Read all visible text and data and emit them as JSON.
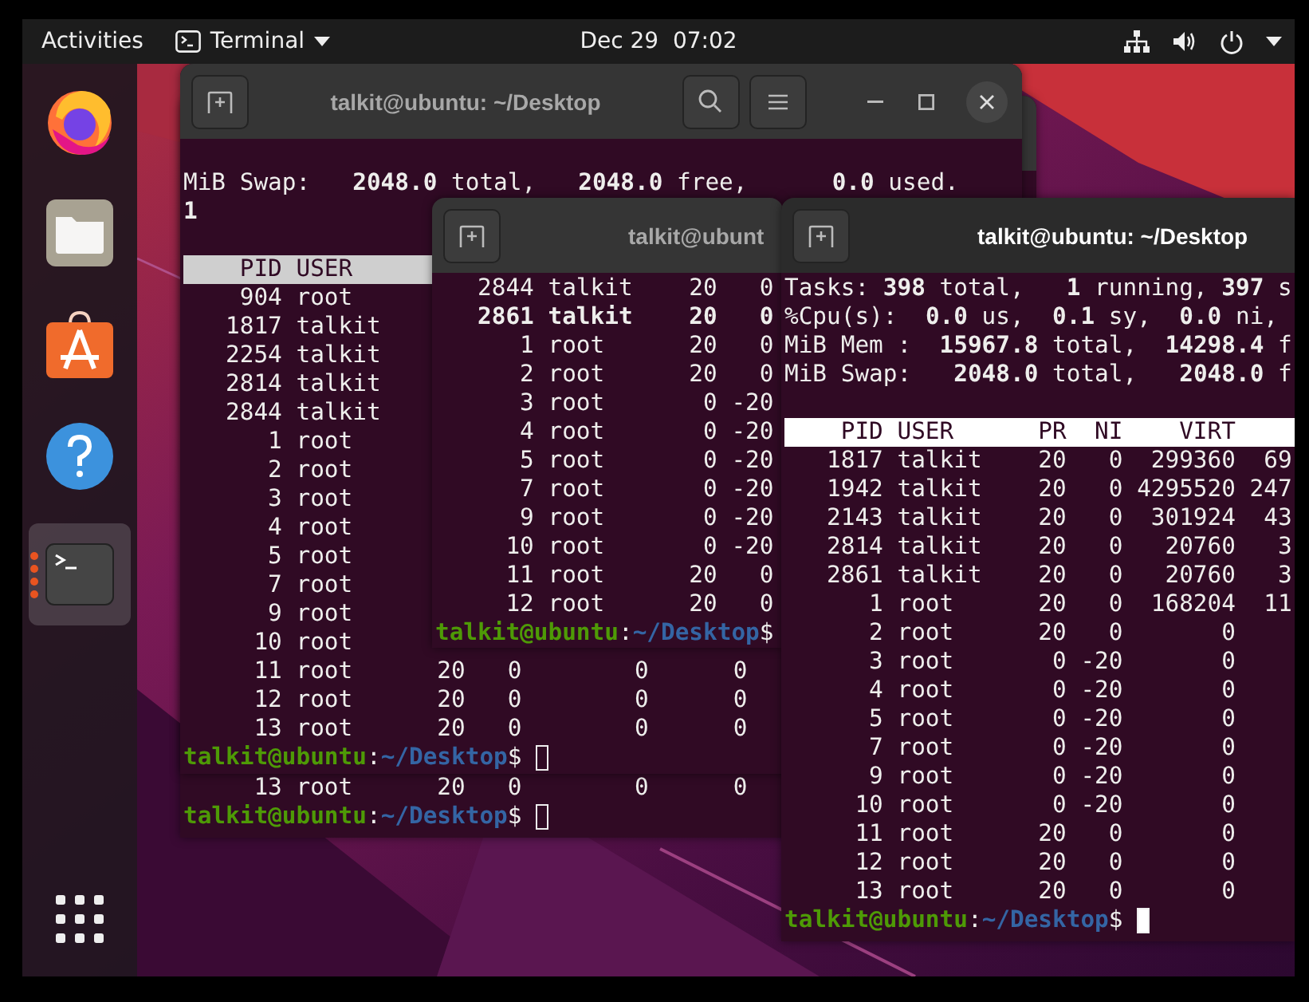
{
  "top_bar": {
    "activities": "Activities",
    "app_menu": "Terminal",
    "clock": "Dec 29  07:02"
  },
  "dock": [
    {
      "kind": "firefox",
      "running": false,
      "selected": false
    },
    {
      "kind": "files",
      "running": false,
      "selected": false
    },
    {
      "kind": "software",
      "running": false,
      "selected": false
    },
    {
      "kind": "help",
      "running": false,
      "selected": false
    },
    {
      "kind": "terminal",
      "running": true,
      "selected": true
    }
  ],
  "windows": [
    {
      "title": "talkit@ubuntu: ~/Desktop",
      "focused": false,
      "lines": [
        {
          "kind": "blank"
        },
        {
          "kind": "text",
          "text": "MiB Swap:   **2048.0** total,   **2048.0** free,      **0.0** used."
        },
        {
          "kind": "text",
          "text": "**1**"
        },
        {
          "kind": "blank"
        },
        {
          "kind": "header",
          "text": "    PID USER"
        },
        {
          "kind": "text",
          "text": "    904 root"
        },
        {
          "kind": "text",
          "text": "   1817 talkit"
        },
        {
          "kind": "text",
          "text": "   2254 talkit"
        },
        {
          "kind": "text",
          "text": "   2814 talkit"
        },
        {
          "kind": "text",
          "text": "   2844 talkit"
        },
        {
          "kind": "text",
          "text": "      1 root"
        },
        {
          "kind": "text",
          "text": "      2 root"
        },
        {
          "kind": "text",
          "text": "      3 root"
        },
        {
          "kind": "text",
          "text": "      4 root"
        },
        {
          "kind": "text",
          "text": "      5 root"
        },
        {
          "kind": "text",
          "text": "      7 root"
        },
        {
          "kind": "text",
          "text": "      9 root"
        },
        {
          "kind": "text",
          "text": "     10 root"
        },
        {
          "kind": "text",
          "text": "     11 root      20   0        0      0"
        },
        {
          "kind": "text",
          "text": "     12 root      20   0        0      0"
        },
        {
          "kind": "text",
          "text": "     13 root      20   0        0      0"
        },
        {
          "kind": "prompt",
          "parts": [
            {
              "kind": "user",
              "text": "talkit@ubuntu"
            },
            {
              "kind": "plain",
              "text": ":"
            },
            {
              "kind": "path",
              "text": "~/Desktop"
            },
            {
              "kind": "plain",
              "text": "$"
            }
          ]
        }
      ]
    },
    {
      "title": "talkit@ubunt",
      "focused": false,
      "lines": [
        {
          "kind": "text",
          "text": "   2844 talkit    20   0"
        },
        {
          "kind": "text",
          "text": "   2861 talkit    20   0",
          "bold": true
        },
        {
          "kind": "text",
          "text": "      1 root      20   0"
        },
        {
          "kind": "text",
          "text": "      2 root      20   0"
        },
        {
          "kind": "text",
          "text": "      3 root       0 -20"
        },
        {
          "kind": "text",
          "text": "      4 root       0 -20"
        },
        {
          "kind": "text",
          "text": "      5 root       0 -20"
        },
        {
          "kind": "text",
          "text": "      7 root       0 -20"
        },
        {
          "kind": "text",
          "text": "      9 root       0 -20"
        },
        {
          "kind": "text",
          "text": "     10 root       0 -20"
        },
        {
          "kind": "text",
          "text": "     11 root      20   0"
        },
        {
          "kind": "text",
          "text": "     12 root      20   0"
        },
        {
          "kind": "prompt",
          "parts": [
            {
              "kind": "user",
              "text": "talkit@ubuntu"
            },
            {
              "kind": "plain",
              "text": ":"
            },
            {
              "kind": "path",
              "text": "~/Desktop"
            },
            {
              "kind": "plain",
              "text": "$"
            }
          ]
        }
      ]
    },
    {
      "focused": false,
      "lines": [
        {
          "kind": "text",
          "text": "     13 root      20   0        0      0"
        },
        {
          "kind": "prompt",
          "parts": [
            {
              "kind": "user",
              "text": "talkit@ubuntu"
            },
            {
              "kind": "plain",
              "text": ":"
            },
            {
              "kind": "path",
              "text": "~/Desktop"
            },
            {
              "kind": "plain",
              "text": "$"
            }
          ]
        }
      ]
    },
    {
      "title": "talkit@ubuntu: ~/Desktop",
      "focused": true,
      "lines": [
        {
          "kind": "text",
          "text": "Tasks: **398** total,   **1** running, **397** s"
        },
        {
          "kind": "text",
          "text": "%Cpu(s):  **0.0** us,  **0.1** sy,  **0.0** ni,"
        },
        {
          "kind": "text",
          "text": "MiB Mem :  **15967.8** total,  **14298.4** f"
        },
        {
          "kind": "text",
          "text": "MiB Swap:   **2048.0** total,   **2048.0** f"
        },
        {
          "kind": "blank"
        },
        {
          "kind": "header",
          "text": "    PID USER      PR  NI    VIRT"
        },
        {
          "kind": "text",
          "text": "   1817 talkit    20   0  299360  69"
        },
        {
          "kind": "text",
          "text": "   1942 talkit    20   0 4295520 247"
        },
        {
          "kind": "text",
          "text": "   2143 talkit    20   0  301924  43"
        },
        {
          "kind": "text",
          "text": "   2814 talkit    20   0   20760   3"
        },
        {
          "kind": "text",
          "text": "   2861 talkit    20   0   20760   3"
        },
        {
          "kind": "text",
          "text": "      1 root      20   0  168204  11"
        },
        {
          "kind": "text",
          "text": "      2 root      20   0       0"
        },
        {
          "kind": "text",
          "text": "      3 root       0 -20       0"
        },
        {
          "kind": "text",
          "text": "      4 root       0 -20       0"
        },
        {
          "kind": "text",
          "text": "      5 root       0 -20       0"
        },
        {
          "kind": "text",
          "text": "      7 root       0 -20       0"
        },
        {
          "kind": "text",
          "text": "      9 root       0 -20       0"
        },
        {
          "kind": "text",
          "text": "     10 root       0 -20       0"
        },
        {
          "kind": "text",
          "text": "     11 root      20   0       0"
        },
        {
          "kind": "text",
          "text": "     12 root      20   0       0"
        },
        {
          "kind": "text",
          "text": "     13 root      20   0       0"
        },
        {
          "kind": "prompt",
          "parts": [
            {
              "kind": "user",
              "text": "talkit@ubuntu"
            },
            {
              "kind": "plain",
              "text": ":"
            },
            {
              "kind": "path",
              "text": "~/Desktop"
            },
            {
              "kind": "plain",
              "text": "$"
            }
          ]
        }
      ]
    }
  ]
}
